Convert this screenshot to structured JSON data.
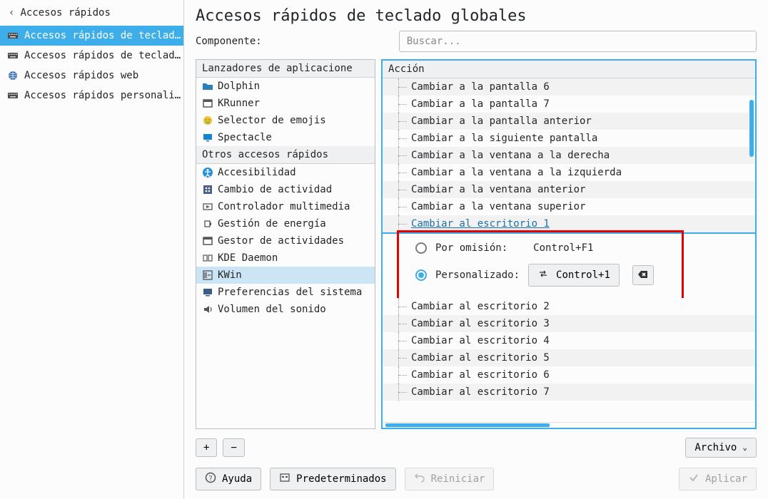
{
  "sidebar": {
    "back_label": "Accesos rápidos",
    "items": [
      {
        "label": "Accesos rápidos de teclad…",
        "icon": "keyboard-icon",
        "selected": true
      },
      {
        "label": "Accesos rápidos de teclad…",
        "icon": "keyboard-icon",
        "selected": false
      },
      {
        "label": "Accesos rápidos web",
        "icon": "globe-icon",
        "selected": false
      },
      {
        "label": "Accesos rápidos personali…",
        "icon": "keyboard-icon",
        "selected": false
      }
    ]
  },
  "header": {
    "title": "Accesos rápidos de teclado globales",
    "component_label": "Componente:",
    "search_placeholder": "Buscar..."
  },
  "component_tree": {
    "groups": [
      {
        "header": "Lanzadores de aplicacione",
        "items": [
          {
            "label": "Dolphin",
            "icon": "folder-icon",
            "color": "#2980b9"
          },
          {
            "label": "KRunner",
            "icon": "window-icon",
            "color": "#565656"
          },
          {
            "label": "Selector de emojis",
            "icon": "emoji-icon",
            "color": "#f2c037"
          },
          {
            "label": "Spectacle",
            "icon": "screen-icon",
            "color": "#1683d0"
          }
        ]
      },
      {
        "header": "Otros accesos rápidos",
        "items": [
          {
            "label": "Accesibilidad",
            "icon": "accessibility-icon",
            "color": "#2691d9"
          },
          {
            "label": "Cambio de actividad",
            "icon": "activity-icon",
            "color": "#4b5e87"
          },
          {
            "label": "Controlador multimedia",
            "icon": "media-icon",
            "color": "#555"
          },
          {
            "label": "Gestión de energía",
            "icon": "power-icon",
            "color": "#555"
          },
          {
            "label": "Gestor de actividades",
            "icon": "window-icon",
            "color": "#555"
          },
          {
            "label": "KDE Daemon",
            "icon": "daemon-icon",
            "color": "#555"
          },
          {
            "label": "KWin",
            "icon": "kwin-icon",
            "color": "#555",
            "selected": true
          },
          {
            "label": "Preferencias del sistema",
            "icon": "settings-icon",
            "color": "#3a5d88"
          },
          {
            "label": "Volumen del sonido",
            "icon": "sound-icon",
            "color": "#555"
          }
        ]
      }
    ]
  },
  "action_panel": {
    "header": "Acción",
    "items": [
      "Cambiar a la pantalla 6",
      "Cambiar a la pantalla 7",
      "Cambiar a la pantalla anterior",
      "Cambiar a la siguiente pantalla",
      "Cambiar a la ventana a la derecha",
      "Cambiar a la ventana a la izquierda",
      "Cambiar a la ventana anterior",
      "Cambiar a la ventana superior",
      "Cambiar al escritorio 1",
      "Cambiar al escritorio 2",
      "Cambiar al escritorio 3",
      "Cambiar al escritorio 4",
      "Cambiar al escritorio 5",
      "Cambiar al escritorio 6",
      "Cambiar al escritorio 7"
    ],
    "active_index": 8,
    "detail": {
      "default_label": "Por omisión:",
      "default_value": "Control+F1",
      "custom_label": "Personalizado:",
      "custom_value": "Control+1",
      "selected": "custom"
    }
  },
  "buttons": {
    "add": "+",
    "remove": "−",
    "file": "Archivo",
    "help": "Ayuda",
    "defaults": "Predeterminados",
    "reset": "Reiniciar",
    "apply": "Aplicar"
  }
}
